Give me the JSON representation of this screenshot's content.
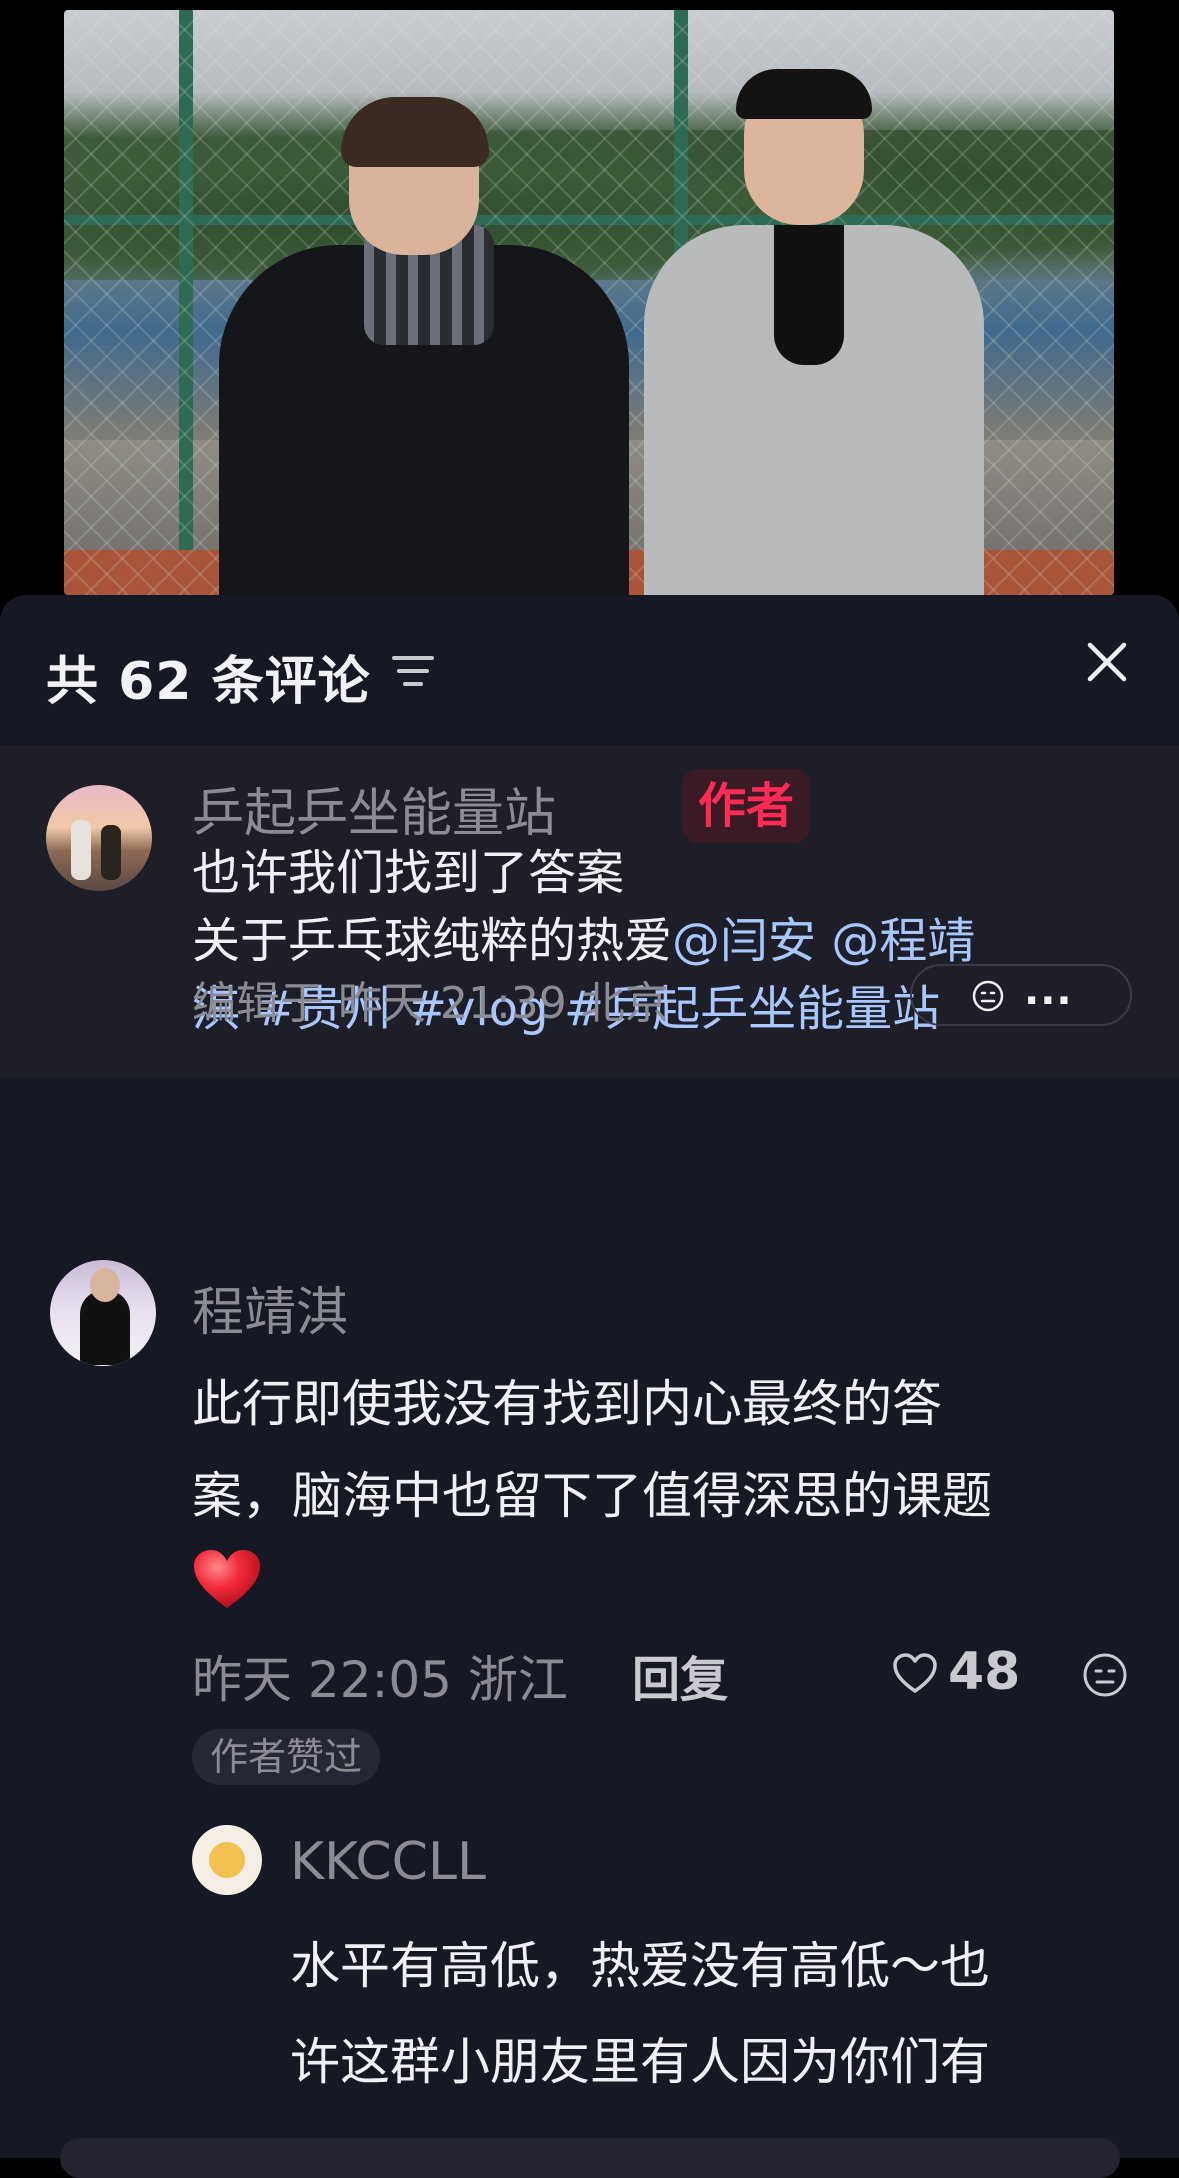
{
  "header": {
    "count_title": "共 62 条评论"
  },
  "pinned_comment": {
    "author": "乒起乒坐能量站",
    "author_badge": "作者",
    "line1": "也许我们找到了答案",
    "line2_prefix": "关于乒乓球纯粹的热爱",
    "mention1": "@闫安",
    "mention2_a": "@程靖",
    "mention2_b": "淇",
    "hashtag1": "#贵州",
    "hashtag2": "#vlog",
    "hashtag3": "#乒起乒坐能量站",
    "meta": "编辑于  昨天 21:39 北京",
    "more": "..."
  },
  "comment": {
    "author": "程靖淇",
    "text_line1": "此行即使我没有找到内心最终的答",
    "text_line2": "案，脑海中也留下了值得深思的课题",
    "meta": "昨天 22:05 浙江",
    "reply_label": "回复",
    "likes": "48",
    "author_liked": "作者赞过"
  },
  "reply": {
    "author": "KKCCLL",
    "text_line1": "水平有高低，热爱没有高低～也",
    "text_line2": "许这群小朋友里有人因为你们有"
  },
  "colors": {
    "sheet_bg": "#161823",
    "pinned_bg": "#1d1e28",
    "badge_red": "#fe2c55",
    "link_blue": "#a9c7ff"
  },
  "icons": [
    "sort-icon",
    "close-icon",
    "emoji-face-icon",
    "more-icon",
    "heart-icon",
    "red-heart-emoji"
  ]
}
